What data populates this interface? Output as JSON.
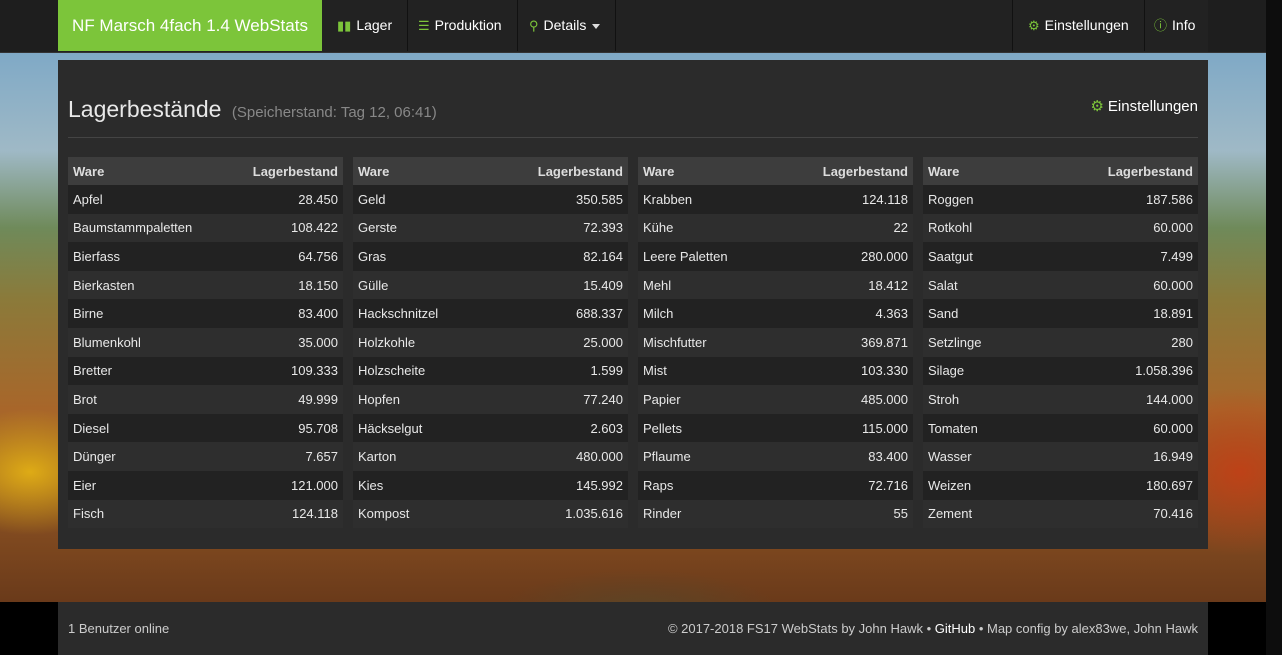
{
  "navbar": {
    "brand": "NF Marsch 4fach 1.4 WebStats",
    "items": [
      {
        "label": "Lager",
        "icon": "bar-chart-icon"
      },
      {
        "label": "Produktion",
        "icon": "list-icon"
      },
      {
        "label": "Details",
        "icon": "search-icon"
      },
      {
        "label": "Einstellungen",
        "icon": "gear-icon"
      },
      {
        "label": "Info",
        "icon": "info-icon"
      }
    ]
  },
  "page": {
    "title": "Lagerbestände",
    "subtitle": "(Speicherstand: Tag 12, 06:41)",
    "settings_label": "Einstellungen"
  },
  "table": {
    "col_ware": "Ware",
    "col_bestand": "Lagerbestand",
    "columns": [
      [
        [
          "Apfel",
          "28.450"
        ],
        [
          "Baumstammpaletten",
          "108.422"
        ],
        [
          "Bierfass",
          "64.756"
        ],
        [
          "Bierkasten",
          "18.150"
        ],
        [
          "Birne",
          "83.400"
        ],
        [
          "Blumenkohl",
          "35.000"
        ],
        [
          "Bretter",
          "109.333"
        ],
        [
          "Brot",
          "49.999"
        ],
        [
          "Diesel",
          "95.708"
        ],
        [
          "Dünger",
          "7.657"
        ],
        [
          "Eier",
          "121.000"
        ],
        [
          "Fisch",
          "124.118"
        ]
      ],
      [
        [
          "Geld",
          "350.585"
        ],
        [
          "Gerste",
          "72.393"
        ],
        [
          "Gras",
          "82.164"
        ],
        [
          "Gülle",
          "15.409"
        ],
        [
          "Hackschnitzel",
          "688.337"
        ],
        [
          "Holzkohle",
          "25.000"
        ],
        [
          "Holzscheite",
          "1.599"
        ],
        [
          "Hopfen",
          "77.240"
        ],
        [
          "Häckselgut",
          "2.603"
        ],
        [
          "Karton",
          "480.000"
        ],
        [
          "Kies",
          "145.992"
        ],
        [
          "Kompost",
          "1.035.616"
        ]
      ],
      [
        [
          "Krabben",
          "124.118"
        ],
        [
          "Kühe",
          "22"
        ],
        [
          "Leere Paletten",
          "280.000"
        ],
        [
          "Mehl",
          "18.412"
        ],
        [
          "Milch",
          "4.363"
        ],
        [
          "Mischfutter",
          "369.871"
        ],
        [
          "Mist",
          "103.330"
        ],
        [
          "Papier",
          "485.000"
        ],
        [
          "Pellets",
          "115.000"
        ],
        [
          "Pflaume",
          "83.400"
        ],
        [
          "Raps",
          "72.716"
        ],
        [
          "Rinder",
          "55"
        ]
      ],
      [
        [
          "Roggen",
          "187.586"
        ],
        [
          "Rotkohl",
          "60.000"
        ],
        [
          "Saatgut",
          "7.499"
        ],
        [
          "Salat",
          "60.000"
        ],
        [
          "Sand",
          "18.891"
        ],
        [
          "Setzlinge",
          "280"
        ],
        [
          "Silage",
          "1.058.396"
        ],
        [
          "Stroh",
          "144.000"
        ],
        [
          "Tomaten",
          "60.000"
        ],
        [
          "Wasser",
          "16.949"
        ],
        [
          "Weizen",
          "180.697"
        ],
        [
          "Zement",
          "70.416"
        ]
      ]
    ]
  },
  "footer": {
    "users_online": "1 Benutzer online",
    "copyright": "© 2017-2018 FS17 WebStats by John Hawk • ",
    "github": "GitHub",
    "mapconfig": " • Map config by alex83we, John Hawk"
  },
  "colors": {
    "accent": "#7cc53a",
    "panel": "#2b2b2b"
  }
}
